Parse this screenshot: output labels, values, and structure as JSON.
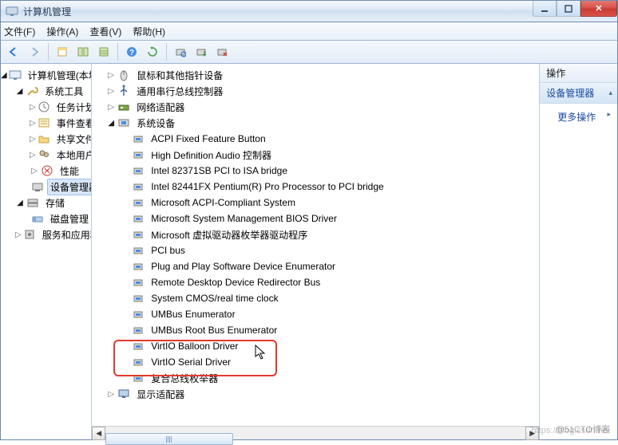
{
  "window": {
    "title": "计算机管理"
  },
  "menus": {
    "file": "文件(F)",
    "action": "操作(A)",
    "view": "查看(V)",
    "help": "帮助(H)"
  },
  "leftTree": {
    "root": "计算机管理(本地)",
    "sysTools": "系统工具",
    "taskSched": "任务计划程序",
    "eventViewer": "事件查看器",
    "sharedFolders": "共享文件夹",
    "localUsers": "本地用户和组",
    "performance": "性能",
    "deviceMgr": "设备管理器",
    "storage": "存储",
    "diskMgmt": "磁盘管理",
    "services": "服务和应用程序"
  },
  "mid": {
    "mouse": "鼠标和其他指针设备",
    "usb": "通用串行总线控制器",
    "network": "网络适配器",
    "sysDevices": "系统设备",
    "items": [
      "ACPI Fixed Feature Button",
      "High Definition Audio 控制器",
      "Intel 82371SB PCI to ISA bridge",
      "Intel 82441FX Pentium(R) Pro Processor to PCI bridge",
      "Microsoft ACPI-Compliant System",
      "Microsoft System Management BIOS Driver",
      "Microsoft 虚拟驱动器枚举器驱动程序",
      "PCI bus",
      "Plug and Play Software Device Enumerator",
      "Remote Desktop Device Redirector Bus",
      "System CMOS/real time clock",
      "UMBus Enumerator",
      "UMBus Root Bus Enumerator",
      "VirtIO Balloon Driver",
      "VirtIO Serial Driver",
      "复合总线枚举器"
    ],
    "display": "显示适配器"
  },
  "rightPane": {
    "header": "操作",
    "sub": "设备管理器",
    "moreActions": "更多操作"
  },
  "watermark1": "https://blog.csdn.net",
  "watermark2": "@51CTO博客"
}
